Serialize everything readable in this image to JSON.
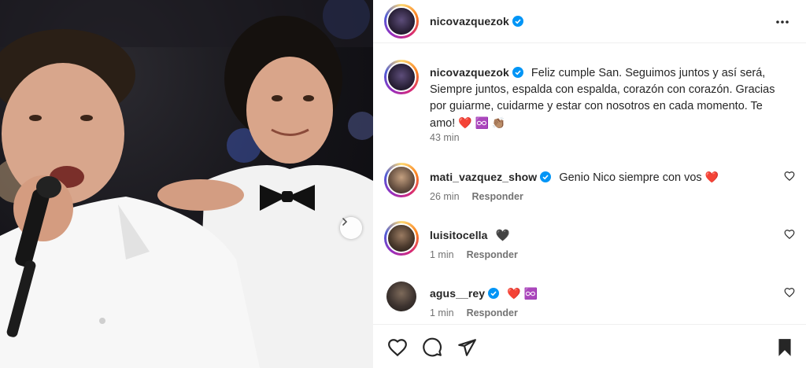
{
  "post": {
    "author": "nicovazquezok",
    "carousel_next_icon": "chevron-right-icon"
  },
  "caption": {
    "username": "nicovazquezok",
    "text": "Feliz cumple San. Seguimos juntos y así será, Siempre juntos, espalda con espalda, corazón con corazón. Gracias por guiarme, cuidarme y estar con nosotros en cada momento. Te amo!",
    "emojis": "❤️ ♾️ 👏🏽",
    "time": "43 min"
  },
  "comments": [
    {
      "username": "mati_vazquez_show",
      "verified": true,
      "text": "Genio Nico siempre con vos",
      "emoji": "❤️",
      "time": "26 min",
      "reply": "Responder"
    },
    {
      "username": "luisitocella",
      "verified": false,
      "text": "",
      "emoji": "🖤",
      "time": "1 min",
      "reply": "Responder"
    },
    {
      "username": "agus__rey",
      "verified": true,
      "text": "",
      "emoji": "❤️ ♾️",
      "time": "1 min",
      "reply": "Responder"
    }
  ],
  "actions": {
    "like_icon": "heart-icon",
    "comment_icon": "comment-icon",
    "share_icon": "send-icon",
    "save_icon": "bookmark-icon"
  },
  "colors": {
    "verified": "#0095f6",
    "heart": "#e0245e",
    "secondary_text": "#737373",
    "border": "#efefef"
  }
}
